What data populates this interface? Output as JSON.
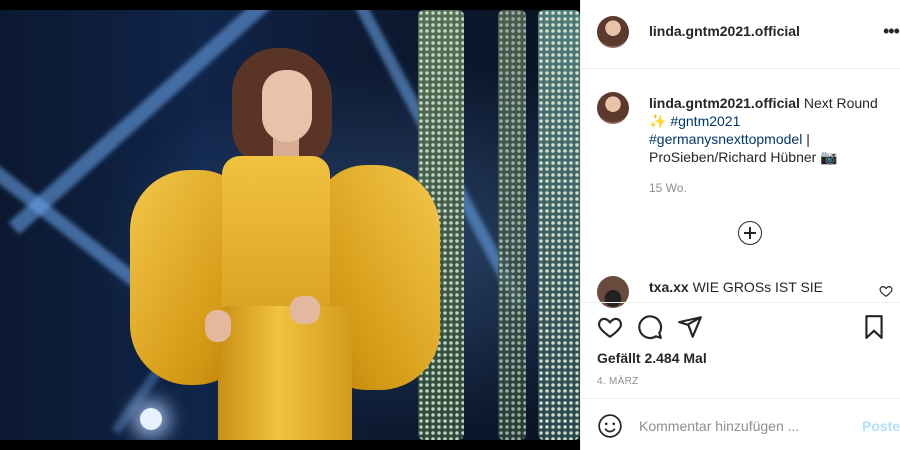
{
  "post": {
    "username": "linda.gntm2021.official",
    "caption_text": "Next Round",
    "caption_emoji": "✨",
    "hashtag1": "#gntm2021",
    "hashtag2": "#germanysnexttopmodel",
    "credit": "| ProSieben/Richard Hübner",
    "credit_emoji": "📷",
    "time_ago": "15 Wo.",
    "more_icon": "•••"
  },
  "comments": [
    {
      "username": "txa.xx",
      "text": "WIE GROSs IST SIE"
    }
  ],
  "likes": "Gefällt 2.484 Mal",
  "date": "4. MÄRZ",
  "comment_input": {
    "placeholder": "Kommentar hinzufügen ...",
    "post_label": "Posten"
  },
  "icons": [
    "heart-icon",
    "comment-icon",
    "share-icon",
    "bookmark-icon",
    "emoji-icon",
    "add-comment-icon",
    "more-options-icon"
  ]
}
